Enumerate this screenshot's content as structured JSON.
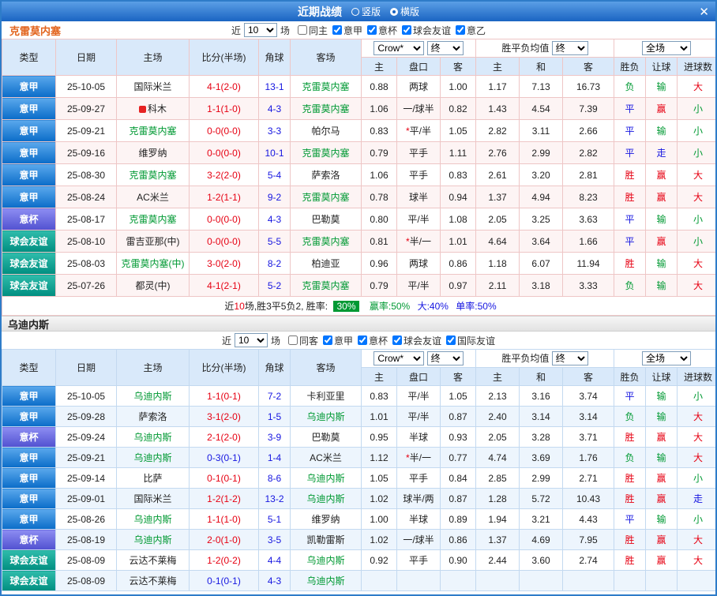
{
  "titlebar": {
    "title": "近期战绩",
    "radio_vertical": "竖版",
    "radio_horizontal": "横版",
    "vertical_selected": false,
    "horizontal_selected": true,
    "close": "✕"
  },
  "colors": {
    "accent_blue": "#1a64c2",
    "win_red": "#e60012",
    "draw_blue": "#1515e0",
    "lose_green": "#009933",
    "league_serie_a": "#0a6cc8",
    "league_cup": "#5151d0",
    "league_friendly": "#008e80",
    "focus_team_green": "#009933",
    "section1_team_orange": "#e2631c"
  },
  "sections": [
    {
      "team": "克雷莫内塞",
      "filter": {
        "near_label": "近",
        "count": "10",
        "games_label": "场",
        "checkboxes": [
          {
            "label": "同主",
            "checked": false
          },
          {
            "label": "意甲",
            "checked": true
          },
          {
            "label": "意杯",
            "checked": true
          },
          {
            "label": "球会友谊",
            "checked": true
          },
          {
            "label": "意乙",
            "checked": true
          }
        ]
      },
      "header": {
        "col_type": "类型",
        "col_date": "日期",
        "col_home": "主场",
        "col_score": "比分(半场)",
        "col_corner": "角球",
        "col_away": "客场",
        "company": "Crow*",
        "final_a": "终",
        "avg_label": "胜平负均值",
        "final_b": "终",
        "scope": "全场",
        "sub_home": "主",
        "sub_pk": "盘口",
        "sub_away": "客",
        "sub_h": "主",
        "sub_d": "和",
        "sub_a": "客",
        "sub_wdl": "胜负",
        "sub_handicap": "让球",
        "sub_goals": "进球数"
      },
      "rows": [
        {
          "lg": "意甲",
          "lgc": "blue",
          "d": "25-10-05",
          "h": "国际米兰",
          "hg": false,
          "hi": false,
          "s": "4-1(2-0)",
          "sc": "r",
          "cn": "13-1",
          "a": "克雷莫内塞",
          "ag": true,
          "o1": "0.88",
          "st": "",
          "pk": "两球",
          "o2": "1.00",
          "m1": "1.17",
          "m2": "7.13",
          "m3": "16.73",
          "r1": {
            "t": "负",
            "c": "g"
          },
          "r2": {
            "t": "输",
            "c": "g"
          },
          "r3": {
            "t": "大",
            "c": "r"
          }
        },
        {
          "lg": "意甲",
          "lgc": "blue",
          "d": "25-09-27",
          "h": "科木",
          "hg": false,
          "hi": true,
          "s": "1-1(1-0)",
          "sc": "r",
          "cn": "4-3",
          "a": "克雷莫内塞",
          "ag": true,
          "o1": "1.06",
          "st": "",
          "pk": "一/球半",
          "o2": "0.82",
          "m1": "1.43",
          "m2": "4.54",
          "m3": "7.39",
          "r1": {
            "t": "平",
            "c": "b"
          },
          "r2": {
            "t": "赢",
            "c": "r"
          },
          "r3": {
            "t": "小",
            "c": "g"
          }
        },
        {
          "lg": "意甲",
          "lgc": "blue",
          "d": "25-09-21",
          "h": "克雷莫内塞",
          "hg": true,
          "hi": false,
          "s": "0-0(0-0)",
          "sc": "r",
          "cn": "3-3",
          "a": "帕尔马",
          "ag": false,
          "o1": "0.83",
          "st": "*",
          "pk": "平/半",
          "o2": "1.05",
          "m1": "2.82",
          "m2": "3.11",
          "m3": "2.66",
          "r1": {
            "t": "平",
            "c": "b"
          },
          "r2": {
            "t": "输",
            "c": "g"
          },
          "r3": {
            "t": "小",
            "c": "g"
          }
        },
        {
          "lg": "意甲",
          "lgc": "blue",
          "d": "25-09-16",
          "h": "维罗纳",
          "hg": false,
          "hi": false,
          "s": "0-0(0-0)",
          "sc": "r",
          "cn": "10-1",
          "a": "克雷莫内塞",
          "ag": true,
          "o1": "0.79",
          "st": "",
          "pk": "平手",
          "o2": "1.11",
          "m1": "2.76",
          "m2": "2.99",
          "m3": "2.82",
          "r1": {
            "t": "平",
            "c": "b"
          },
          "r2": {
            "t": "走",
            "c": "b"
          },
          "r3": {
            "t": "小",
            "c": "g"
          }
        },
        {
          "lg": "意甲",
          "lgc": "blue",
          "d": "25-08-30",
          "h": "克雷莫内塞",
          "hg": true,
          "hi": false,
          "s": "3-2(2-0)",
          "sc": "r",
          "cn": "5-4",
          "a": "萨索洛",
          "ag": false,
          "o1": "1.06",
          "st": "",
          "pk": "平手",
          "o2": "0.83",
          "m1": "2.61",
          "m2": "3.20",
          "m3": "2.81",
          "r1": {
            "t": "胜",
            "c": "r"
          },
          "r2": {
            "t": "赢",
            "c": "r"
          },
          "r3": {
            "t": "大",
            "c": "r"
          }
        },
        {
          "lg": "意甲",
          "lgc": "blue",
          "d": "25-08-24",
          "h": "AC米兰",
          "hg": false,
          "hi": false,
          "s": "1-2(1-1)",
          "sc": "r",
          "cn": "9-2",
          "a": "克雷莫内塞",
          "ag": true,
          "o1": "0.78",
          "st": "",
          "pk": "球半",
          "o2": "0.94",
          "m1": "1.37",
          "m2": "4.94",
          "m3": "8.23",
          "r1": {
            "t": "胜",
            "c": "r"
          },
          "r2": {
            "t": "赢",
            "c": "r"
          },
          "r3": {
            "t": "大",
            "c": "r"
          }
        },
        {
          "lg": "意杯",
          "lgc": "purple",
          "d": "25-08-17",
          "h": "克雷莫内塞",
          "hg": true,
          "hi": false,
          "s": "0-0(0-0)",
          "sc": "r",
          "cn": "4-3",
          "a": "巴勒莫",
          "ag": false,
          "o1": "0.80",
          "st": "",
          "pk": "平/半",
          "o2": "1.08",
          "m1": "2.05",
          "m2": "3.25",
          "m3": "3.63",
          "r1": {
            "t": "平",
            "c": "b"
          },
          "r2": {
            "t": "输",
            "c": "g"
          },
          "r3": {
            "t": "小",
            "c": "g"
          }
        },
        {
          "lg": "球会友谊",
          "lgc": "teal",
          "d": "25-08-10",
          "h": "雷吉亚那(中)",
          "hg": false,
          "hi": false,
          "s": "0-0(0-0)",
          "sc": "r",
          "cn": "5-5",
          "a": "克雷莫内塞",
          "ag": true,
          "o1": "0.81",
          "st": "*",
          "pk": "半/一",
          "o2": "1.01",
          "m1": "4.64",
          "m2": "3.64",
          "m3": "1.66",
          "r1": {
            "t": "平",
            "c": "b"
          },
          "r2": {
            "t": "赢",
            "c": "r"
          },
          "r3": {
            "t": "小",
            "c": "g"
          }
        },
        {
          "lg": "球会友谊",
          "lgc": "teal",
          "d": "25-08-03",
          "h": "克雷莫内塞(中)",
          "hg": true,
          "hi": false,
          "s": "3-0(2-0)",
          "sc": "r",
          "cn": "8-2",
          "a": "柏迪亚",
          "ag": false,
          "o1": "0.96",
          "st": "",
          "pk": "两球",
          "o2": "0.86",
          "m1": "1.18",
          "m2": "6.07",
          "m3": "11.94",
          "r1": {
            "t": "胜",
            "c": "r"
          },
          "r2": {
            "t": "输",
            "c": "g"
          },
          "r3": {
            "t": "大",
            "c": "r"
          }
        },
        {
          "lg": "球会友谊",
          "lgc": "teal",
          "d": "25-07-26",
          "h": "都灵(中)",
          "hg": false,
          "hi": false,
          "s": "4-1(2-1)",
          "sc": "r",
          "cn": "5-2",
          "a": "克雷莫内塞",
          "ag": true,
          "o1": "0.79",
          "st": "",
          "pk": "平/半",
          "o2": "0.97",
          "m1": "2.11",
          "m2": "3.18",
          "m3": "3.33",
          "r1": {
            "t": "负",
            "c": "g"
          },
          "r2": {
            "t": "输",
            "c": "g"
          },
          "r3": {
            "t": "大",
            "c": "r"
          }
        }
      ],
      "summary": {
        "prefix": "近",
        "count": "10",
        "mid": "场,胜3平5负2, 胜率:",
        "win_rate": "30%",
        "cover": "赢率:50%",
        "big": "大:40%",
        "single": "单率:50%"
      }
    },
    {
      "team": "乌迪内斯",
      "filter": {
        "near_label": "近",
        "count": "10",
        "games_label": "场",
        "checkboxes": [
          {
            "label": "同客",
            "checked": false
          },
          {
            "label": "意甲",
            "checked": true
          },
          {
            "label": "意杯",
            "checked": true
          },
          {
            "label": "球会友谊",
            "checked": true
          },
          {
            "label": "国际友谊",
            "checked": true
          }
        ]
      },
      "header": {
        "col_type": "类型",
        "col_date": "日期",
        "col_home": "主场",
        "col_score": "比分(半场)",
        "col_corner": "角球",
        "col_away": "客场",
        "company": "Crow*",
        "final_a": "终",
        "avg_label": "胜平负均值",
        "final_b": "终",
        "scope": "全场",
        "sub_home": "主",
        "sub_pk": "盘口",
        "sub_away": "客",
        "sub_h": "主",
        "sub_d": "和",
        "sub_a": "客",
        "sub_wdl": "胜负",
        "sub_handicap": "让球",
        "sub_goals": "进球数"
      },
      "rows": [
        {
          "lg": "意甲",
          "lgc": "blue",
          "d": "25-10-05",
          "h": "乌迪内斯",
          "hg": true,
          "hi": false,
          "s": "1-1(0-1)",
          "sc": "r",
          "cn": "7-2",
          "a": "卡利亚里",
          "ag": false,
          "o1": "0.83",
          "st": "",
          "pk": "平/半",
          "o2": "1.05",
          "m1": "2.13",
          "m2": "3.16",
          "m3": "3.74",
          "r1": {
            "t": "平",
            "c": "b"
          },
          "r2": {
            "t": "输",
            "c": "g"
          },
          "r3": {
            "t": "小",
            "c": "g"
          }
        },
        {
          "lg": "意甲",
          "lgc": "blue",
          "d": "25-09-28",
          "h": "萨索洛",
          "hg": false,
          "hi": false,
          "s": "3-1(2-0)",
          "sc": "r",
          "cn": "1-5",
          "a": "乌迪内斯",
          "ag": true,
          "o1": "1.01",
          "st": "",
          "pk": "平/半",
          "o2": "0.87",
          "m1": "2.40",
          "m2": "3.14",
          "m3": "3.14",
          "r1": {
            "t": "负",
            "c": "g"
          },
          "r2": {
            "t": "输",
            "c": "g"
          },
          "r3": {
            "t": "大",
            "c": "r"
          }
        },
        {
          "lg": "意杯",
          "lgc": "purple",
          "d": "25-09-24",
          "h": "乌迪内斯",
          "hg": true,
          "hi": false,
          "s": "2-1(2-0)",
          "sc": "r",
          "cn": "3-9",
          "a": "巴勒莫",
          "ag": false,
          "o1": "0.95",
          "st": "",
          "pk": "半球",
          "o2": "0.93",
          "m1": "2.05",
          "m2": "3.28",
          "m3": "3.71",
          "r1": {
            "t": "胜",
            "c": "r"
          },
          "r2": {
            "t": "赢",
            "c": "r"
          },
          "r3": {
            "t": "大",
            "c": "r"
          }
        },
        {
          "lg": "意甲",
          "lgc": "blue",
          "d": "25-09-21",
          "h": "乌迪内斯",
          "hg": true,
          "hi": false,
          "s": "0-3(0-1)",
          "sc": "b",
          "cn": "1-4",
          "a": "AC米兰",
          "ag": false,
          "o1": "1.12",
          "st": "*",
          "pk": "半/一",
          "o2": "0.77",
          "m1": "4.74",
          "m2": "3.69",
          "m3": "1.76",
          "r1": {
            "t": "负",
            "c": "g"
          },
          "r2": {
            "t": "输",
            "c": "g"
          },
          "r3": {
            "t": "大",
            "c": "r"
          }
        },
        {
          "lg": "意甲",
          "lgc": "blue",
          "d": "25-09-14",
          "h": "比萨",
          "hg": false,
          "hi": false,
          "s": "0-1(0-1)",
          "sc": "r",
          "cn": "8-6",
          "a": "乌迪内斯",
          "ag": true,
          "o1": "1.05",
          "st": "",
          "pk": "平手",
          "o2": "0.84",
          "m1": "2.85",
          "m2": "2.99",
          "m3": "2.71",
          "r1": {
            "t": "胜",
            "c": "r"
          },
          "r2": {
            "t": "赢",
            "c": "r"
          },
          "r3": {
            "t": "小",
            "c": "g"
          }
        },
        {
          "lg": "意甲",
          "lgc": "blue",
          "d": "25-09-01",
          "h": "国际米兰",
          "hg": false,
          "hi": false,
          "s": "1-2(1-2)",
          "sc": "r",
          "cn": "13-2",
          "a": "乌迪内斯",
          "ag": true,
          "o1": "1.02",
          "st": "",
          "pk": "球半/两",
          "o2": "0.87",
          "m1": "1.28",
          "m2": "5.72",
          "m3": "10.43",
          "r1": {
            "t": "胜",
            "c": "r"
          },
          "r2": {
            "t": "赢",
            "c": "r"
          },
          "r3": {
            "t": "走",
            "c": "b"
          }
        },
        {
          "lg": "意甲",
          "lgc": "blue",
          "d": "25-08-26",
          "h": "乌迪内斯",
          "hg": true,
          "hi": false,
          "s": "1-1(1-0)",
          "sc": "r",
          "cn": "5-1",
          "a": "维罗纳",
          "ag": false,
          "o1": "1.00",
          "st": "",
          "pk": "半球",
          "o2": "0.89",
          "m1": "1.94",
          "m2": "3.21",
          "m3": "4.43",
          "r1": {
            "t": "平",
            "c": "b"
          },
          "r2": {
            "t": "输",
            "c": "g"
          },
          "r3": {
            "t": "小",
            "c": "g"
          }
        },
        {
          "lg": "意杯",
          "lgc": "purple",
          "d": "25-08-19",
          "h": "乌迪内斯",
          "hg": true,
          "hi": false,
          "s": "2-0(1-0)",
          "sc": "r",
          "cn": "3-5",
          "a": "凯勒雷斯",
          "ag": false,
          "o1": "1.02",
          "st": "",
          "pk": "一/球半",
          "o2": "0.86",
          "m1": "1.37",
          "m2": "4.69",
          "m3": "7.95",
          "r1": {
            "t": "胜",
            "c": "r"
          },
          "r2": {
            "t": "赢",
            "c": "r"
          },
          "r3": {
            "t": "大",
            "c": "r"
          }
        },
        {
          "lg": "球会友谊",
          "lgc": "teal",
          "d": "25-08-09",
          "h": "云达不莱梅",
          "hg": false,
          "hi": false,
          "s": "1-2(0-2)",
          "sc": "r",
          "cn": "4-4",
          "a": "乌迪内斯",
          "ag": true,
          "o1": "0.92",
          "st": "",
          "pk": "平手",
          "o2": "0.90",
          "m1": "2.44",
          "m2": "3.60",
          "m3": "2.74",
          "r1": {
            "t": "胜",
            "c": "r"
          },
          "r2": {
            "t": "赢",
            "c": "r"
          },
          "r3": {
            "t": "大",
            "c": "r"
          }
        },
        {
          "lg": "球会友谊",
          "lgc": "teal",
          "d": "25-08-09",
          "h": "云达不莱梅",
          "hg": false,
          "hi": false,
          "s": "0-1(0-1)",
          "sc": "b",
          "cn": "4-3",
          "a": "乌迪内斯",
          "ag": true,
          "o1": "",
          "st": "",
          "pk": "",
          "o2": "",
          "m1": "",
          "m2": "",
          "m3": "",
          "r1": {
            "t": "",
            "c": "b"
          },
          "r2": {
            "t": "",
            "c": "b"
          },
          "r3": {
            "t": "",
            "c": "b"
          }
        }
      ]
    }
  ]
}
